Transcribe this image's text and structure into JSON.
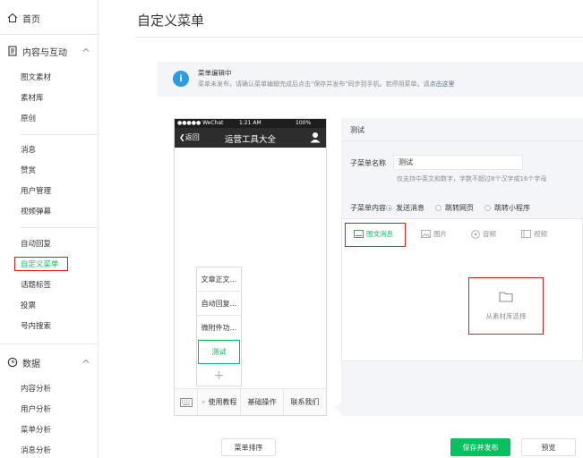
{
  "sidebar": {
    "home": "首页",
    "content_section": "内容与互动",
    "content_items": [
      "图文素材",
      "素材库",
      "原创"
    ],
    "interaction_items": [
      "消息",
      "赞赏",
      "用户管理",
      "视频弹幕"
    ],
    "feature_items": [
      "自动回复",
      "自定义菜单",
      "话题标签",
      "投票",
      "号内搜索"
    ],
    "data_section": "数据",
    "data_items": [
      "内容分析",
      "用户分析",
      "菜单分析",
      "消息分析"
    ]
  },
  "page": {
    "title": "自定义菜单"
  },
  "notice": {
    "icon": "i",
    "title": "菜单编辑中",
    "text": "菜单未发布，请确认菜单编辑完成后点击\"保存并发布\"同步到手机。若停用菜单，请",
    "link": "点击这里"
  },
  "phone": {
    "carrier": "●●●●● WeChat",
    "time": "1:21 AM",
    "battery": "100%",
    "back": "返回",
    "title": "运营工具大全",
    "sub_menu": [
      "文章正文...",
      "自动回复...",
      "微附件功...",
      "测试"
    ],
    "plus": "+",
    "bottom_tabs": [
      "使用教程",
      "基础操作",
      "联系我们"
    ]
  },
  "editor": {
    "header": "测试",
    "name_label": "子菜单名称",
    "name_value": "测试",
    "name_hint": "仅支持中英文和数字，字数不超过8个汉字或16个字母",
    "content_label": "子菜单内容",
    "radio_options": [
      "发送消息",
      "跳转网页",
      "跳转小程序"
    ],
    "content_tabs": [
      "图文消息",
      "图片",
      "音频",
      "视频"
    ],
    "library_text": "从素材库选择"
  },
  "footer": {
    "sort": "菜单排序",
    "save": "保存并发布",
    "preview": "预览"
  },
  "colors": {
    "accent": "#07c160",
    "highlight": "#e21a1a",
    "info": "#2c9ae6"
  }
}
